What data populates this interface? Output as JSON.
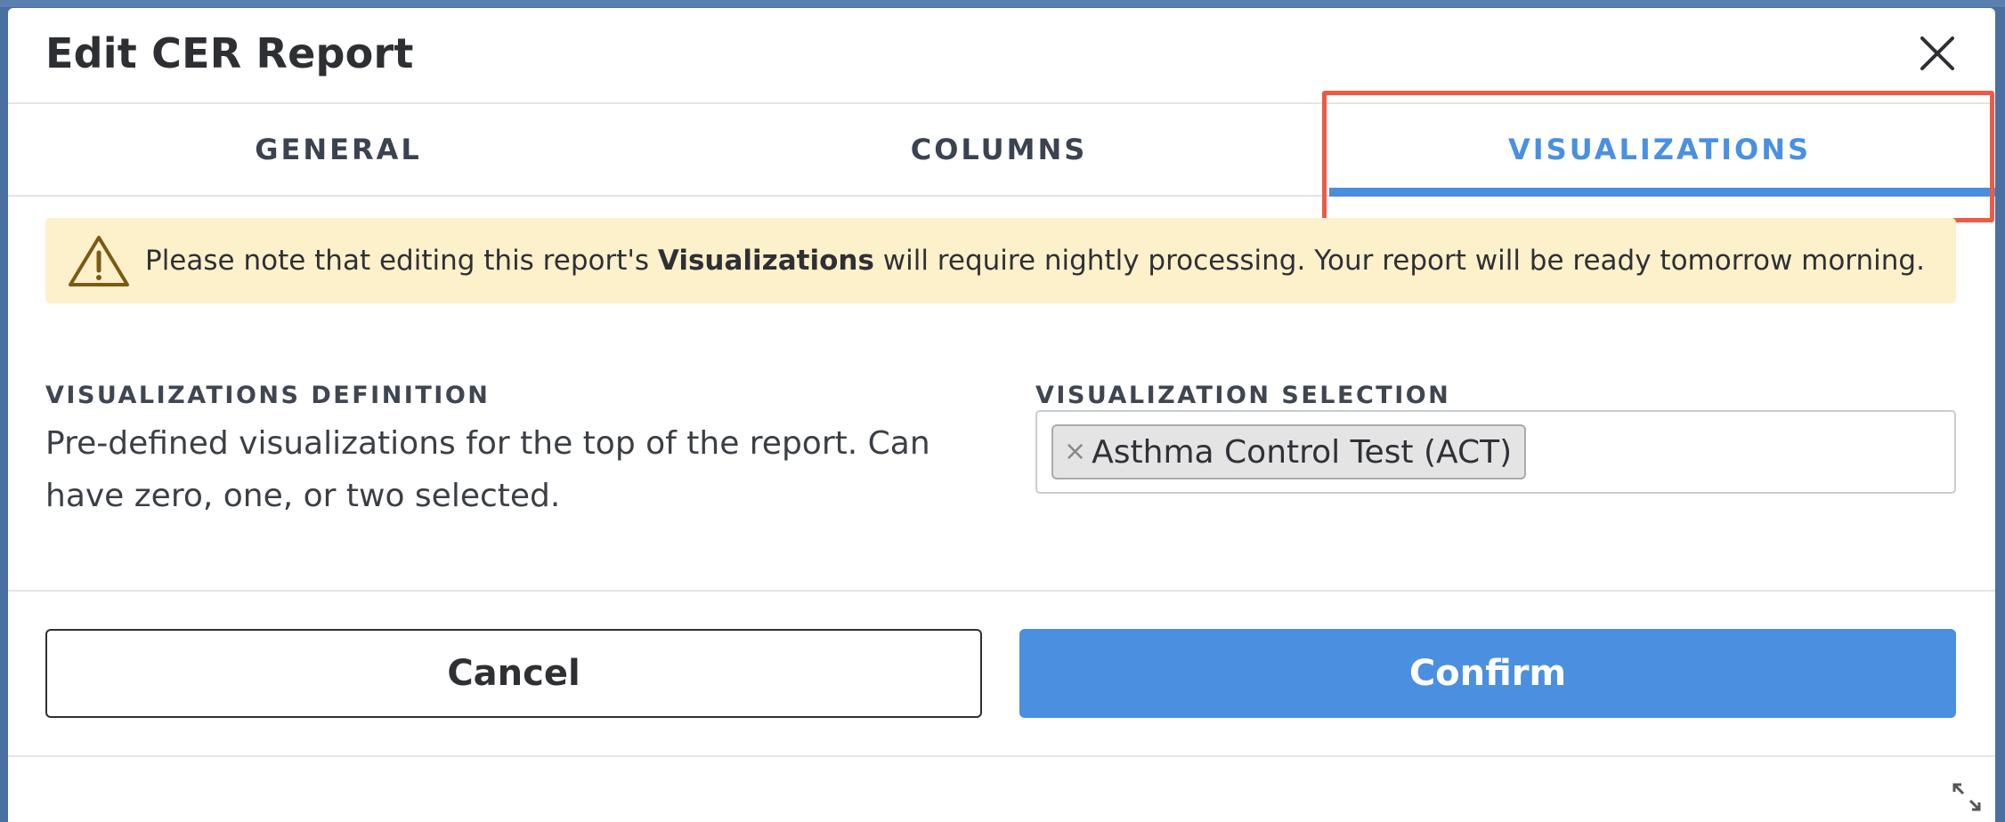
{
  "modal": {
    "title": "Edit CER Report",
    "close_icon": "close-icon"
  },
  "tabs": [
    {
      "label": "GENERAL",
      "active": false
    },
    {
      "label": "COLUMNS",
      "active": false
    },
    {
      "label": "VISUALIZATIONS",
      "active": true
    }
  ],
  "alert": {
    "icon": "warning-icon",
    "text_before": "Please note that editing this report's ",
    "text_bold": "Visualizations",
    "text_after": " will require nightly processing. Your report will be ready tomorrow morning."
  },
  "definition": {
    "label": "VISUALIZATIONS DEFINITION",
    "description": "Pre-defined visualizations for the top of the report. Can have zero, one, or two selected."
  },
  "selection": {
    "label": "VISUALIZATION SELECTION",
    "selected": [
      {
        "label": "Asthma Control Test (ACT)",
        "remove_glyph": "×"
      }
    ]
  },
  "footer": {
    "cancel_label": "Cancel",
    "confirm_label": "Confirm",
    "expand_icon": "expand-icon"
  },
  "colors": {
    "accent": "#4a8fe0",
    "highlight": "#ee5a44",
    "alert_bg": "#fdf1cc"
  }
}
